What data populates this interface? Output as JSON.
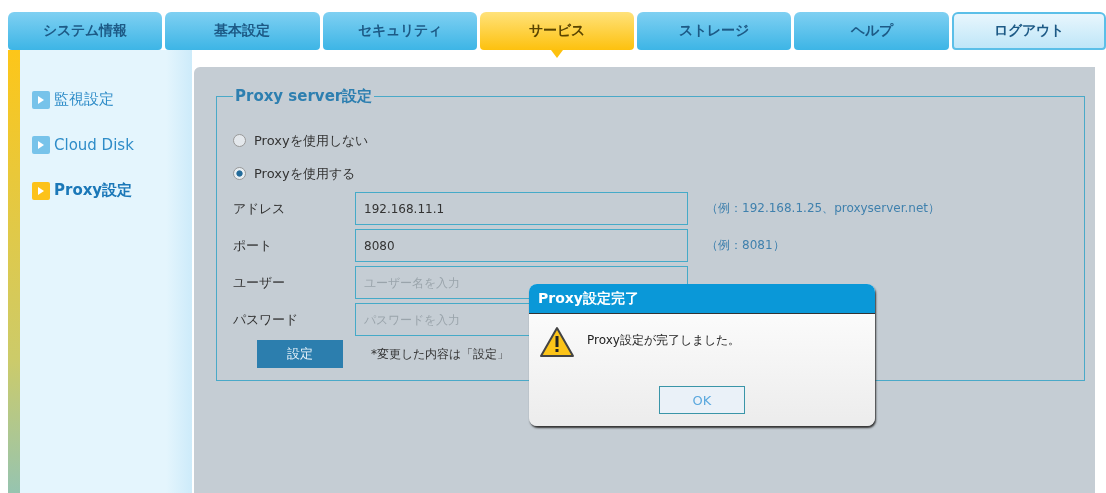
{
  "tabs": [
    {
      "label": "システム情報",
      "selected": false
    },
    {
      "label": "基本設定",
      "selected": false
    },
    {
      "label": "セキュリティ",
      "selected": false
    },
    {
      "label": "サービス",
      "selected": true
    },
    {
      "label": "ストレージ",
      "selected": false
    },
    {
      "label": "ヘルプ",
      "selected": false
    },
    {
      "label": "ログアウト",
      "selected": false,
      "kind": "logout"
    }
  ],
  "sidebar": {
    "items": [
      {
        "label": "監視設定",
        "selected": false
      },
      {
        "label": "Cloud Disk",
        "selected": false
      },
      {
        "label": "Proxy設定",
        "selected": true
      }
    ]
  },
  "proxy_settings": {
    "title": "Proxy server設定",
    "options": [
      {
        "label": "Proxyを使用しない",
        "selected": false
      },
      {
        "label": "Proxyを使用する",
        "selected": true
      }
    ],
    "fields": [
      {
        "label": "アドレス",
        "value": "192.168.11.1",
        "hint": "（例：192.168.1.25、proxyserver.net）"
      },
      {
        "label": "ポート",
        "value": "8080",
        "hint": "（例：8081）"
      },
      {
        "label": "ユーザー",
        "placeholder": "ユーザー名を入力"
      },
      {
        "label": "パスワード",
        "placeholder": "パスワードを入力"
      }
    ],
    "submit": "設定",
    "note": "*変更した内容は「設定」"
  },
  "dialog": {
    "title": "Proxy設定完了",
    "message": "Proxy設定が完了しました。",
    "button": "OK"
  }
}
